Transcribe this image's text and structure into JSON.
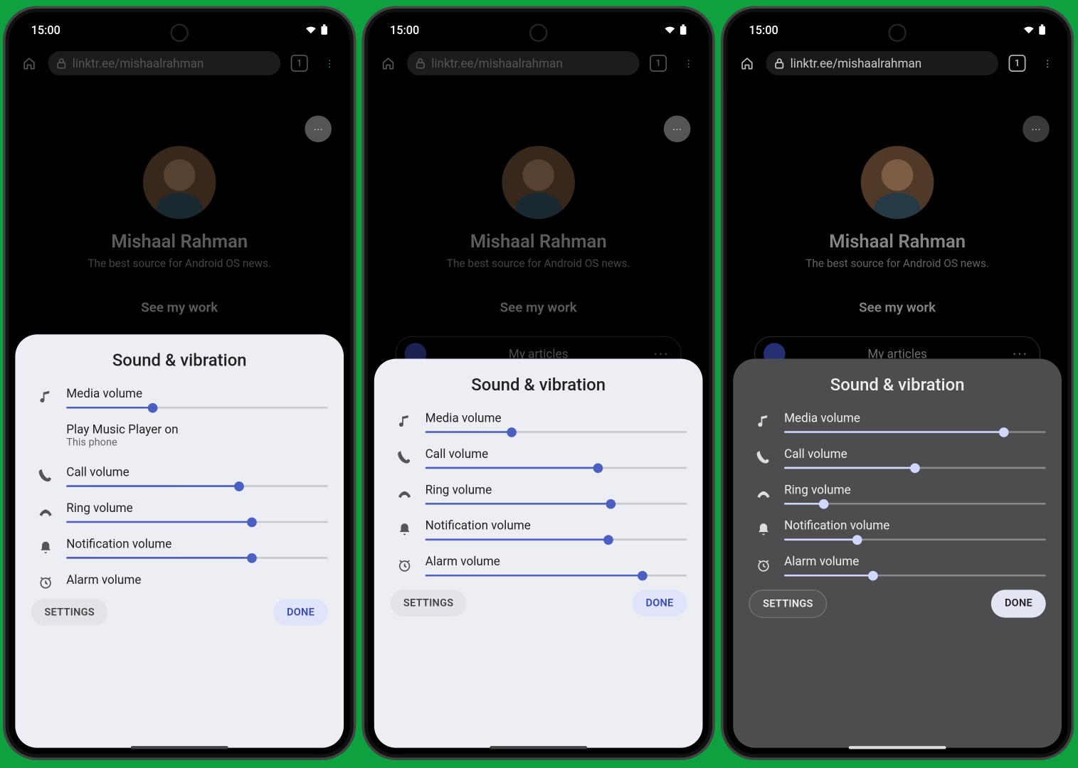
{
  "status": {
    "time": "15:00",
    "tab_count": "1"
  },
  "browser": {
    "url": "linktr.ee/mishaalrahman"
  },
  "linktree": {
    "name": "Mishaal Rahman",
    "tagline": "The best source for Android OS news.",
    "cta": "See my work",
    "card1": "My articles"
  },
  "panel": {
    "title": "Sound & vibration",
    "media_label": "Media volume",
    "play_on_label": "Play Music Player on",
    "play_on_target": "This phone",
    "call_label": "Call volume",
    "ring_label": "Ring volume",
    "notif_label": "Notification volume",
    "alarm_label": "Alarm volume",
    "settings_btn": "SETTINGS",
    "done_btn": "DONE"
  },
  "sliders": {
    "p1": {
      "media": 33,
      "call": 66,
      "ring": 71,
      "notif": 71
    },
    "p2": {
      "media": 33,
      "call": 66,
      "ring": 71,
      "notif": 70,
      "alarm": 83
    },
    "p3": {
      "media": 84,
      "call": 50,
      "ring": 15,
      "notif": 28,
      "alarm": 34
    }
  }
}
